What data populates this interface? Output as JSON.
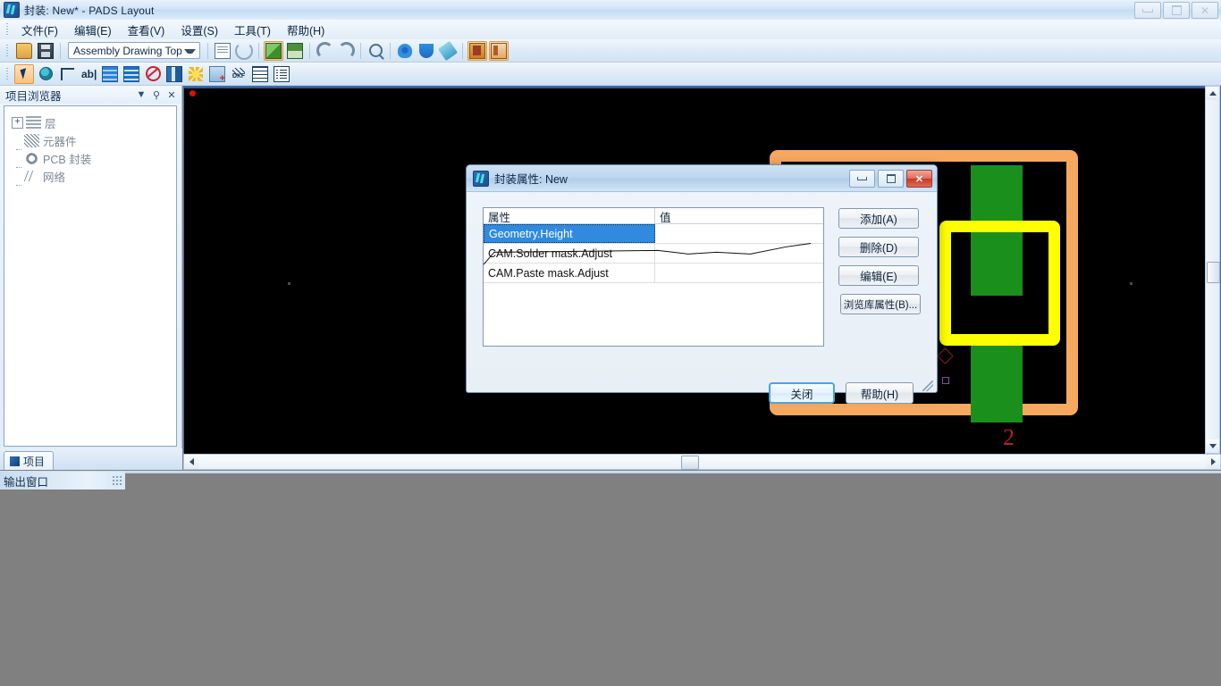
{
  "window": {
    "title": "封装: New* - PADS Layout",
    "icon": "pads-logo-icon",
    "controls": [
      {
        "name": "minimize-button",
        "glyph": "—"
      },
      {
        "name": "maximize-button",
        "glyph": "❐"
      },
      {
        "name": "close-button",
        "glyph": "✕"
      }
    ]
  },
  "menubar": {
    "items": [
      {
        "label": "文件(F)",
        "name": "menu-file"
      },
      {
        "label": "编辑(E)",
        "name": "menu-edit"
      },
      {
        "label": "查看(V)",
        "name": "menu-view"
      },
      {
        "label": "设置(S)",
        "name": "menu-setup"
      },
      {
        "label": "工具(T)",
        "name": "menu-tools"
      },
      {
        "label": "帮助(H)",
        "name": "menu-help"
      }
    ]
  },
  "toolbar": {
    "layer_combo_value": "Assembly Drawing Top",
    "row1_icons": [
      "open-file-icon",
      "save-file-icon",
      "properties-icon",
      "refresh-icon",
      "pour-manager-icon",
      "plane-layer-icon",
      "undo-icon",
      "redo-icon",
      "zoom-icon",
      "pan-icon",
      "rotate-view-icon",
      "redraw-icon",
      "toggle-panel-icon",
      "toggle-browser-icon"
    ],
    "row2_icons": [
      "select-tool-icon",
      "spin-icon",
      "pick-tool-icon",
      "text-tool-icon",
      "layer-bars-icon",
      "layer-bars-alt-icon",
      "no-entry-icon",
      "library-icon",
      "flash-icon",
      "measure-icon",
      "dxf-export-icon",
      "grid-icon",
      "list-icon"
    ]
  },
  "browser": {
    "title": "项目浏览器",
    "header_buttons": [
      {
        "name": "browser-menu-button",
        "glyph": "▼"
      },
      {
        "name": "pin-button",
        "glyph": "📌"
      },
      {
        "name": "close-panel-button",
        "glyph": "✕"
      }
    ],
    "tree": [
      {
        "label": "层",
        "icon": "layers-icon",
        "expandable": true,
        "expander": "+"
      },
      {
        "label": "元器件",
        "icon": "components-icon",
        "expandable": false
      },
      {
        "label": "PCB 封装",
        "icon": "pcb-decal-icon",
        "expandable": false
      },
      {
        "label": "网络",
        "icon": "nets-icon",
        "expandable": false
      }
    ],
    "tab_label": "项目"
  },
  "output_window": {
    "title": "输出窗口"
  },
  "canvas": {
    "reference_designator": "2",
    "origin_marker": "origin-dot",
    "colors": {
      "background": "#000000",
      "board_outline": "#f6a95e",
      "pad": "#1b8f1b",
      "trace": "#ffff00",
      "silkscreen_text": "#b02020",
      "origin": "#d81010"
    }
  },
  "dialog": {
    "title": "封装属性: New",
    "icon": "pads-logo-icon",
    "controls": [
      {
        "name": "dialog-minimize-button",
        "glyph": "—"
      },
      {
        "name": "dialog-maximize-button",
        "glyph": "❐"
      },
      {
        "name": "dialog-close-button",
        "glyph": "✕"
      }
    ],
    "table": {
      "columns": [
        "属性",
        "值"
      ],
      "rows": [
        {
          "attribute": "Geometry.Height",
          "value": "",
          "selected": true
        },
        {
          "attribute": "CAM.Solder mask.Adjust",
          "value": "",
          "selected": false
        },
        {
          "attribute": "CAM.Paste mask.Adjust",
          "value": "",
          "selected": false
        }
      ]
    },
    "buttons": {
      "add": "添加(A)",
      "delete": "删除(D)",
      "edit": "编辑(E)",
      "browse_library": "浏览库属性(B)...",
      "close": "关闭",
      "help": "帮助(H)"
    }
  },
  "scrollbars": {
    "vertical_thumb_position": "middle",
    "horizontal_thumb_position": "middle"
  }
}
